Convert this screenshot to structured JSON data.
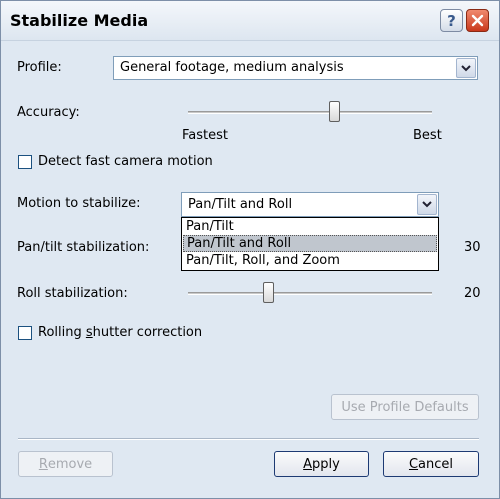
{
  "window": {
    "title": "Stabilize Media"
  },
  "profile": {
    "label": "Profile:",
    "value": "General footage, medium analysis"
  },
  "accuracy": {
    "label": "Accuracy:",
    "min_label": "Fastest",
    "max_label": "Best",
    "level": 0.6
  },
  "detect_fast_motion": {
    "label": "Detect fast camera motion",
    "checked": false
  },
  "motion": {
    "label": "Motion to stabilize:",
    "value": "Pan/Tilt and Roll",
    "options": [
      "Pan/Tilt",
      "Pan/Tilt and Roll",
      "Pan/Tilt, Roll, and Zoom"
    ],
    "selected_index": 1
  },
  "pan_tilt": {
    "label": "Pan/tilt stabilization:",
    "value": "30"
  },
  "roll": {
    "label": "Roll stabilization:",
    "value": "20",
    "level": 0.33
  },
  "rolling_shutter": {
    "label_pre": "Rolling ",
    "label_u": "s",
    "label_post": "hutter correction",
    "checked": false
  },
  "buttons": {
    "use_defaults": "Use Profile Defaults",
    "remove_u": "R",
    "remove_rest": "emove",
    "apply_u": "A",
    "apply_rest": "pply",
    "cancel_u": "C",
    "cancel_rest": "ancel"
  },
  "icons": [
    "help-icon",
    "close-icon",
    "chevron-down-icon"
  ]
}
